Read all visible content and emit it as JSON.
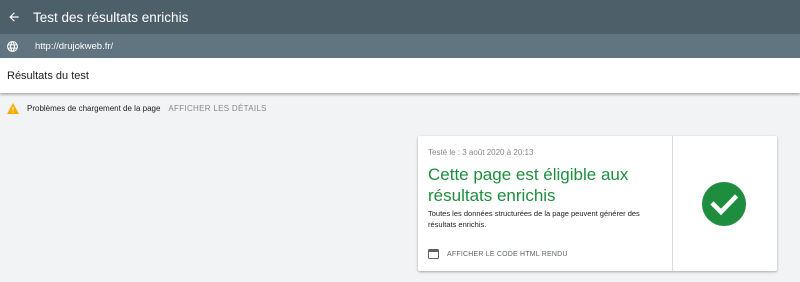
{
  "header": {
    "title": "Test des résultats enrichis",
    "back_icon": "arrow-back-icon"
  },
  "url_bar": {
    "url": "http://drujokweb.fr/",
    "icon": "globe-icon"
  },
  "results": {
    "title": "Résultats du test"
  },
  "warning": {
    "icon": "warning-icon",
    "color": "#f9ab00",
    "text": "Problèmes de chargement de la page",
    "details_link": "AFFICHER LES DÉTAILS"
  },
  "card": {
    "tested_label": "Testé le : 3 août 2020 à 20:13",
    "headline": "Cette page est éligible aux résultats enrichis",
    "description": "Toutes les données structurées de la page peuvent générer des résultats enrichis.",
    "view_code_label": "AFFICHER LE CODE HTML RENDU",
    "view_code_icon": "code-window-icon",
    "status_icon": "check-circle-icon",
    "accent_color": "#1e8e3e"
  },
  "colors": {
    "topbar": "#4d5f68",
    "urlbar": "#607580",
    "background": "#f1f3f4"
  }
}
